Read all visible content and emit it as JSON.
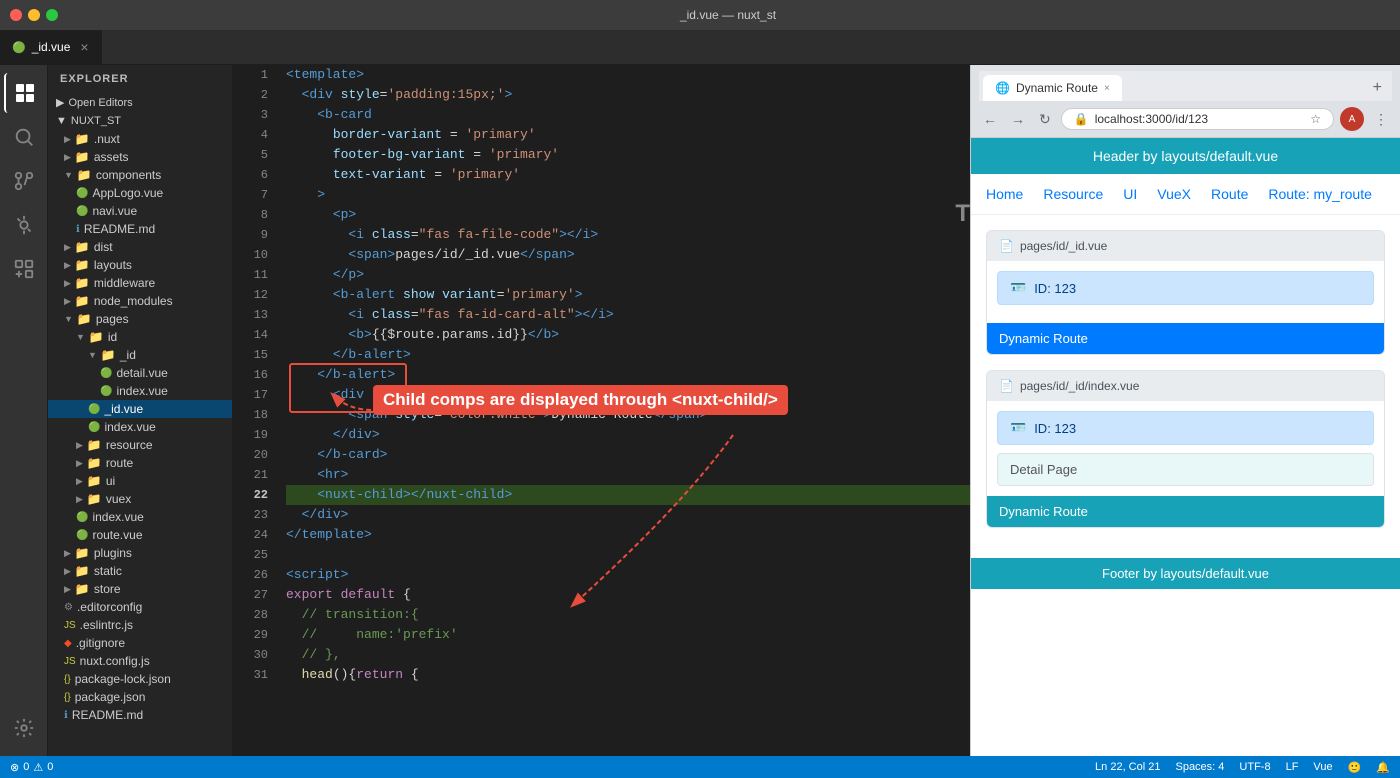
{
  "titleBar": {
    "title": "_id.vue — nuxt_st"
  },
  "tabs": [
    {
      "label": "_id.vue",
      "icon": "🟢",
      "active": true,
      "closable": true
    }
  ],
  "sidebar": {
    "header": "Explorer",
    "sections": {
      "openEditors": "Open Editors",
      "project": "NUXT_ST"
    },
    "tree": [
      {
        "indent": 0,
        "type": "folder",
        "label": ".nuxt",
        "open": false
      },
      {
        "indent": 0,
        "type": "folder",
        "label": "assets",
        "open": false
      },
      {
        "indent": 0,
        "type": "folder-open",
        "label": "components",
        "open": true
      },
      {
        "indent": 1,
        "type": "vue",
        "label": "AppLogo.vue"
      },
      {
        "indent": 1,
        "type": "vue",
        "label": "navi.vue"
      },
      {
        "indent": 1,
        "type": "md",
        "label": "README.md"
      },
      {
        "indent": 0,
        "type": "folder",
        "label": "dist",
        "open": false
      },
      {
        "indent": 0,
        "type": "folder",
        "label": "layouts",
        "open": false
      },
      {
        "indent": 0,
        "type": "folder",
        "label": "middleware",
        "open": false
      },
      {
        "indent": 0,
        "type": "folder",
        "label": "node_modules",
        "open": false
      },
      {
        "indent": 0,
        "type": "folder-open",
        "label": "pages",
        "open": true
      },
      {
        "indent": 1,
        "type": "folder-open",
        "label": "id",
        "open": true
      },
      {
        "indent": 2,
        "type": "folder-open",
        "label": "_id",
        "open": true
      },
      {
        "indent": 3,
        "type": "vue",
        "label": "detail.vue"
      },
      {
        "indent": 3,
        "type": "vue",
        "label": "index.vue"
      },
      {
        "indent": 2,
        "type": "vue",
        "label": "_id.vue",
        "selected": true
      },
      {
        "indent": 2,
        "type": "vue",
        "label": "index.vue"
      },
      {
        "indent": 1,
        "type": "folder",
        "label": "resource",
        "open": false
      },
      {
        "indent": 1,
        "type": "folder",
        "label": "route",
        "open": false
      },
      {
        "indent": 1,
        "type": "folder",
        "label": "ui",
        "open": false
      },
      {
        "indent": 1,
        "type": "folder",
        "label": "vuex",
        "open": false
      },
      {
        "indent": 1,
        "type": "vue",
        "label": "index.vue"
      },
      {
        "indent": 1,
        "type": "vue",
        "label": "route.vue"
      },
      {
        "indent": 0,
        "type": "folder",
        "label": "plugins",
        "open": false
      },
      {
        "indent": 0,
        "type": "folder",
        "label": "static",
        "open": false
      },
      {
        "indent": 0,
        "type": "folder",
        "label": "store",
        "open": false
      },
      {
        "indent": 0,
        "type": "gear",
        "label": ".editorconfig"
      },
      {
        "indent": 0,
        "type": "js",
        "label": ".eslintrc.js"
      },
      {
        "indent": 0,
        "type": "git",
        "label": ".gitignore"
      },
      {
        "indent": 0,
        "type": "js",
        "label": "nuxt.config.js"
      },
      {
        "indent": 0,
        "type": "json",
        "label": "package-lock.json"
      },
      {
        "indent": 0,
        "type": "json",
        "label": "package.json"
      },
      {
        "indent": 0,
        "type": "md",
        "label": "README.md"
      }
    ]
  },
  "editor": {
    "filename": "_id.vue",
    "lines": [
      {
        "num": 1,
        "content": "<template>",
        "type": "normal"
      },
      {
        "num": 2,
        "content": "  <div style='padding:15px;'>",
        "type": "normal"
      },
      {
        "num": 3,
        "content": "    <b-card",
        "type": "normal"
      },
      {
        "num": 4,
        "content": "      border-variant = 'primary'",
        "type": "normal"
      },
      {
        "num": 5,
        "content": "      footer-bg-variant = 'primary'",
        "type": "normal"
      },
      {
        "num": 6,
        "content": "      text-variant = 'primary'",
        "type": "normal"
      },
      {
        "num": 7,
        "content": "    >",
        "type": "normal"
      },
      {
        "num": 8,
        "content": "      <p>",
        "type": "normal"
      },
      {
        "num": 9,
        "content": "        <i class=\"fas fa-file-code\"></i>",
        "type": "normal"
      },
      {
        "num": 10,
        "content": "        <span>pages/id/_id.vue</span>",
        "type": "normal"
      },
      {
        "num": 11,
        "content": "      </p>",
        "type": "normal"
      },
      {
        "num": 12,
        "content": "      <b-alert show variant='primary'>",
        "type": "normal"
      },
      {
        "num": 13,
        "content": "        <i class=\"fas fa-id-card-alt\"></i>",
        "type": "normal"
      },
      {
        "num": 14,
        "content": "        <b>{{$route.params.id}}</b>",
        "type": "normal"
      },
      {
        "num": 15,
        "content": "      </b-alert>",
        "type": "normal"
      },
      {
        "num": 16,
        "content": "    </b-alert>",
        "type": "normal"
      },
      {
        "num": 17,
        "content": "      <div slot=\"footer\">",
        "type": "normal"
      },
      {
        "num": 18,
        "content": "        <span style='color:white'>Dynamic Route</span>",
        "type": "normal"
      },
      {
        "num": 19,
        "content": "      </div>",
        "type": "normal"
      },
      {
        "num": 20,
        "content": "    </b-card>",
        "type": "normal"
      },
      {
        "num": 21,
        "content": "    <hr>",
        "type": "normal"
      },
      {
        "num": 22,
        "content": "    <nuxt-child></nuxt-child>",
        "type": "highlighted"
      },
      {
        "num": 23,
        "content": "  </div>",
        "type": "normal"
      },
      {
        "num": 24,
        "content": "</template>",
        "type": "normal"
      },
      {
        "num": 25,
        "content": "",
        "type": "normal"
      },
      {
        "num": 26,
        "content": "<script>",
        "type": "normal"
      },
      {
        "num": 27,
        "content": "export default {",
        "type": "normal"
      },
      {
        "num": 28,
        "content": "  // transition:{",
        "type": "normal"
      },
      {
        "num": 29,
        "content": "  //     name:'prefix'",
        "type": "normal"
      },
      {
        "num": 30,
        "content": "  // },",
        "type": "normal"
      },
      {
        "num": 31,
        "content": "  head(){return {",
        "type": "normal"
      }
    ]
  },
  "statusBar": {
    "errors": "0",
    "warnings": "0",
    "branch": "Ln 22, Col 21",
    "spaces": "Spaces: 4",
    "encoding": "UTF-8",
    "lineEnding": "LF",
    "language": "Vue"
  },
  "browser": {
    "title": "Dynamic Route",
    "url": "localhost:3000/id/123",
    "headerText": "Header by layouts/default.vue",
    "navLinks": [
      "Home",
      "Resource",
      "UI",
      "VueX",
      "Route",
      "Route: my_route"
    ],
    "card1": {
      "header": "pages/id/_id.vue",
      "alertText": "ID: 123",
      "footerText": "Dynamic Route"
    },
    "card2": {
      "header": "pages/id/_id/index.vue",
      "alertText": "ID: 123",
      "subCardText": "Detail Page",
      "footerText": "Dynamic Route"
    },
    "footer": "Footer by layouts/default.vue"
  },
  "annotation": {
    "text": "Child comps are displayed through <nuxt-child/>"
  },
  "activityBar": {
    "icons": [
      "📁",
      "🔍",
      "⎇",
      "🐛",
      "🧩"
    ]
  }
}
